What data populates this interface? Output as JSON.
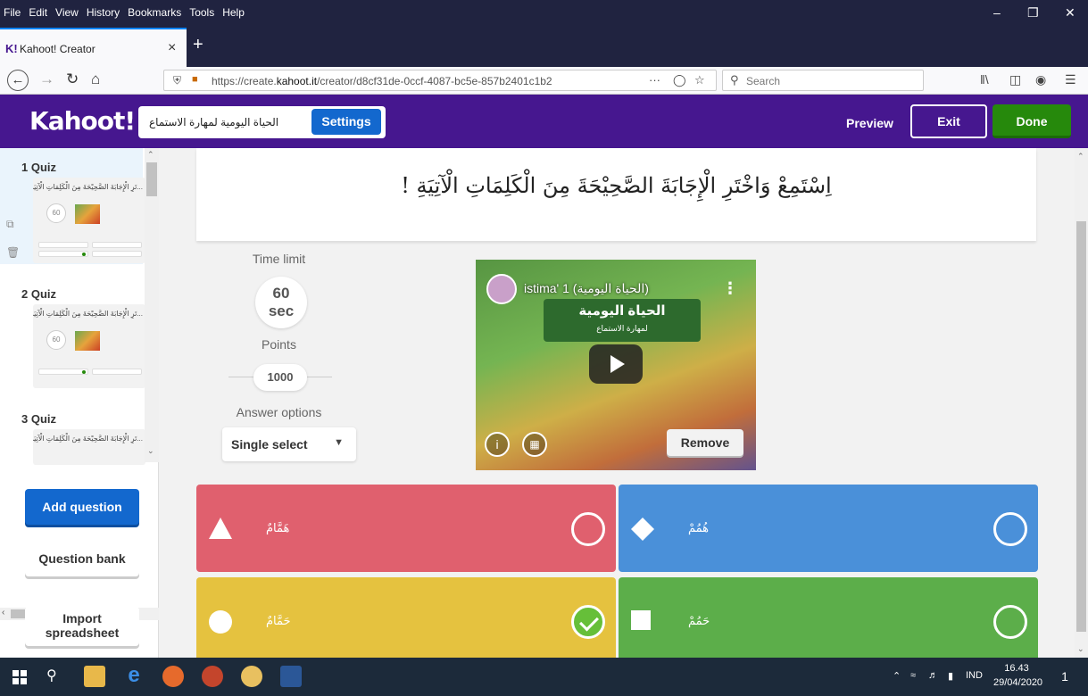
{
  "browser": {
    "menu": [
      "File",
      "Edit",
      "View",
      "History",
      "Bookmarks",
      "Tools",
      "Help"
    ],
    "tab_title": "Kahoot! Creator",
    "tab_icon": "K!",
    "url_prefix": "https://create.",
    "url_domain": "kahoot.it",
    "url_path": "/creator/d8cf31de-0ccf-4087-bc5e-857b2401c1b2",
    "url_actions": "···",
    "search_placeholder": "Search",
    "accent": "#0a84ff"
  },
  "header": {
    "logo": "Kahoot!",
    "kahoot_title": "الحياة اليومية لمهارة الاستماع",
    "settings_label": "Settings",
    "preview_label": "Preview",
    "exit_label": "Exit",
    "done_label": "Done",
    "brand_color": "#46178f"
  },
  "sidebar": {
    "questions": [
      {
        "label": "1 Quiz",
        "snippet": "...تَرِ الْإِجَابَةَ الصَّحِيْحَةَ مِنَ الْكَلِمَاتِ الْآتِيَةِ !",
        "time": "60"
      },
      {
        "label": "2 Quiz",
        "snippet": "...تَرِ الْإِجَابَةَ الصَّحِيْحَةَ مِنَ الْكَلِمَاتِ الْآتِيَةِ !",
        "time": "60"
      },
      {
        "label": "3 Quiz",
        "snippet": "...تَرِ الْإِجَابَةَ الصَّحِيْحَةَ مِنَ الْكَلِمَاتِ الْآتِيَةِ !",
        "time": ""
      }
    ],
    "add_question": "Add question",
    "question_bank": "Question bank",
    "import_line1": "Import",
    "import_line2": "spreadsheet"
  },
  "editor": {
    "question_text": "اِسْتَمِعْ وَاخْتَرِ الْإِجَابَةَ الصَّحِيْحَةَ مِنَ الْكَلِمَاتِ الْآتِيَةِ !",
    "time_limit_label": "Time limit",
    "time_value": "60",
    "time_unit": "sec",
    "points_label": "Points",
    "points_value": "1000",
    "answer_options_label": "Answer options",
    "answer_option_value": "Single select",
    "video_title": "istima' 1 (الحياة اليومية)",
    "video_board_text": "الحياة اليومية",
    "video_board_sub": "لمهارة الاستماع",
    "remove_label": "Remove",
    "answers": [
      {
        "text": "هَمَّامٌ",
        "color": "#e0606e",
        "shape": "triangle",
        "correct": false
      },
      {
        "text": "هُمُمْ",
        "color": "#4a90d9",
        "shape": "diamond",
        "correct": false
      },
      {
        "text": "حَمَّامٌ",
        "color": "#e5c23f",
        "shape": "circle",
        "correct": true
      },
      {
        "text": "حَمُمْ",
        "color": "#5cae4a",
        "shape": "square",
        "correct": false
      }
    ]
  },
  "taskbar": {
    "lang": "IND",
    "time": "16.43",
    "date": "29/04/2020",
    "notification_count": "1"
  }
}
